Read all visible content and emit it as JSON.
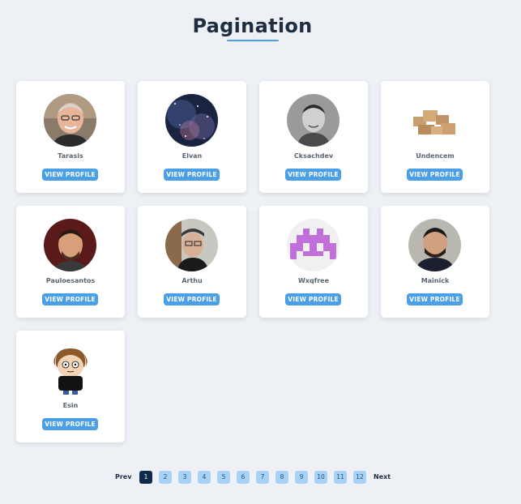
{
  "page": {
    "title": "Pagination"
  },
  "profiles": [
    {
      "name": "Tarasis",
      "button": "VIEW PROFILE"
    },
    {
      "name": "Elvan",
      "button": "VIEW PROFILE"
    },
    {
      "name": "Cksachdev",
      "button": "VIEW PROFILE"
    },
    {
      "name": "Undencem",
      "button": "VIEW PROFILE"
    },
    {
      "name": "Pauloesantos",
      "button": "VIEW PROFILE"
    },
    {
      "name": "Arthu",
      "button": "VIEW PROFILE"
    },
    {
      "name": "Wxqfree",
      "button": "VIEW PROFILE"
    },
    {
      "name": "Mainick",
      "button": "VIEW PROFILE"
    },
    {
      "name": "Esin",
      "button": "VIEW PROFILE"
    }
  ],
  "pagination": {
    "prev": "Prev",
    "next": "Next",
    "current": 1,
    "pages": [
      "1",
      "2",
      "3",
      "4",
      "5",
      "6",
      "7",
      "8",
      "9",
      "10",
      "11",
      "12"
    ]
  },
  "colors": {
    "background": "#edf1f6",
    "accent": "#4a9fe6",
    "active_page": "#0f2a4a",
    "page_button": "#a8d2f5"
  }
}
